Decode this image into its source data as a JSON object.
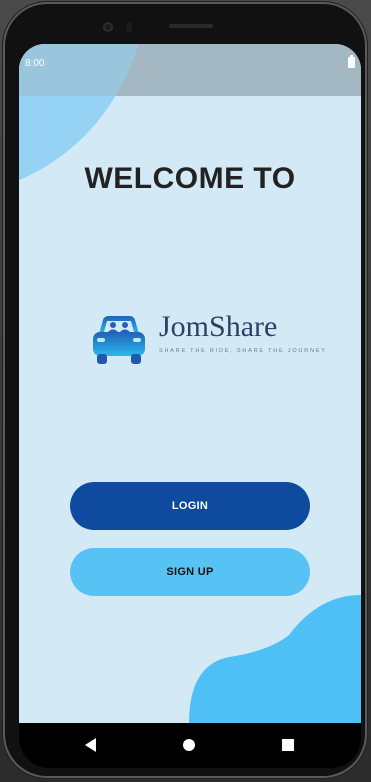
{
  "status_bar": {
    "time": "8:00",
    "battery_icon": "battery-full-icon"
  },
  "main": {
    "welcome_title": "WELCOME TO",
    "logo": {
      "name": "JomShare",
      "tagline": "SHARE THE RIDE, SHARE THE JOURNEY",
      "icon": "car-with-passengers-icon"
    },
    "buttons": {
      "login_label": "LOGIN",
      "signup_label": "SIGN UP"
    }
  },
  "nav_bar": {
    "back_icon": "back-triangle-icon",
    "home_icon": "home-circle-icon",
    "recents_icon": "recents-square-icon"
  },
  "colors": {
    "screen_bg": "#d3e9f6",
    "status_bar_bg": "#a3b8c3",
    "login_button": "#0e4b9e",
    "signup_button": "#56c3f4",
    "accent_blob": "#4fc0f5",
    "title_text": "#222222",
    "logo_text": "#2f3f66"
  }
}
